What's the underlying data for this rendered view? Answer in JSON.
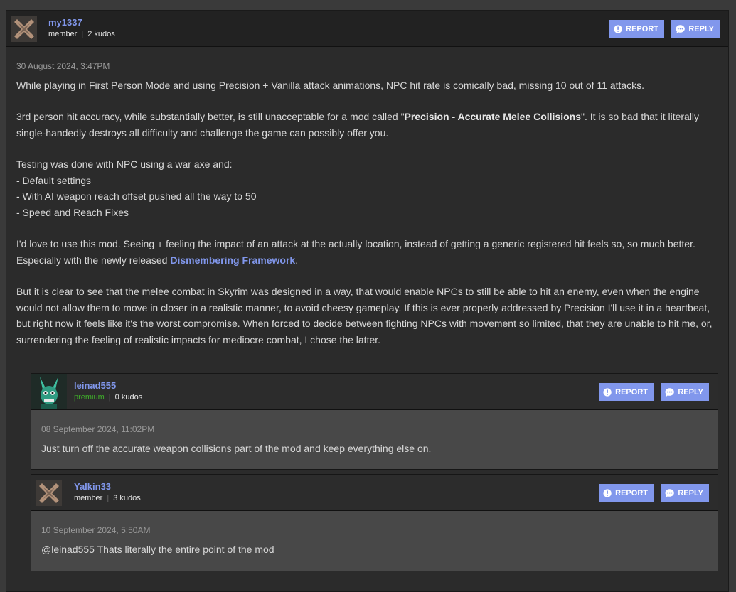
{
  "post": {
    "username": "my1337",
    "role": "member",
    "kudos": "2 kudos",
    "date": "30 August 2024, 3:47PM",
    "report_label": "REPORT",
    "reply_label": "REPLY",
    "p1": "While playing in First Person Mode and using Precision + Vanilla attack animations, NPC hit rate is comically bad, missing 10 out of 11 attacks.",
    "p2_a": "3rd person hit accuracy, while substantially better, is still unacceptable for a mod called \"",
    "p2_bold": "Precision - Accurate Melee Collisions",
    "p2_b": "\". It is so bad that it literally single-handedly destroys all difficulty and challenge the game can possibly offer you.",
    "p3_lines": [
      "Testing was done with NPC using a war axe and:",
      "- Default settings",
      "- With AI weapon reach offset pushed all the way to 50",
      "- Speed and Reach Fixes"
    ],
    "p4_a": "I'd love to use this mod. Seeing + feeling the impact of an attack at the actually location, instead of getting a generic registered hit feels so, so much better. Especially with the newly released ",
    "p4_link": "Dismembering Framework",
    "p4_b": ".",
    "p5": "But it is clear to see that the melee combat in Skyrim was designed in a way, that would enable NPCs to still be able to hit an enemy, even when the engine would not allow them to move in closer in a realistic manner, to avoid cheesy gameplay. If this is ever properly addressed by Precision I'll use it in a heartbeat, but right now it feels like it's the worst compromise. When forced to decide between fighting NPCs with movement so limited, that they are unable to hit me, or, surrendering the feeling of realistic impacts for mediocre combat, I chose the latter."
  },
  "replies": [
    {
      "username": "leinad555",
      "role": "premium",
      "kudos": "0 kudos",
      "date": "08 September 2024, 11:02PM",
      "text": "Just turn off the accurate weapon collisions part of the mod and keep everything else on.",
      "report_label": "REPORT",
      "reply_label": "REPLY"
    },
    {
      "username": "Yalkin33",
      "role": "member",
      "kudos": "3 kudos",
      "date": "10 September 2024, 5:50AM",
      "text": "@leinad555 Thats literally the entire point of the mod",
      "report_label": "REPORT",
      "reply_label": "REPLY"
    }
  ],
  "colors": {
    "accent": "#8197ec",
    "premium": "#3fae2a"
  }
}
